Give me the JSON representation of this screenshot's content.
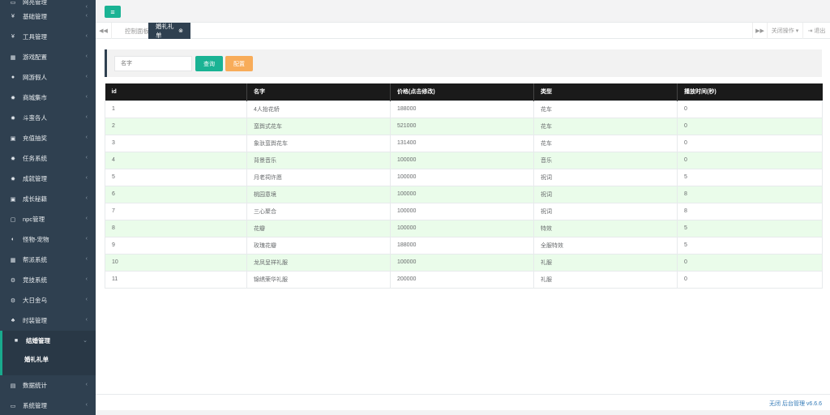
{
  "sidebar": {
    "items": [
      {
        "label": "网亮管理",
        "icon": "monitor-icon",
        "glyph": "▭"
      },
      {
        "label": "基础管理",
        "icon": "cutlery-icon",
        "glyph": "¥"
      },
      {
        "label": "工具管理",
        "icon": "cutlery-icon",
        "glyph": "¥"
      },
      {
        "label": "游戏配置",
        "icon": "grid-icon",
        "glyph": "▦"
      },
      {
        "label": "网游假人",
        "icon": "user-icon",
        "glyph": "●"
      },
      {
        "label": "商城集市",
        "icon": "gear-icon",
        "glyph": "✸"
      },
      {
        "label": "斗蛮各人",
        "icon": "gear-icon",
        "glyph": "✸"
      },
      {
        "label": "充值抽奖",
        "icon": "ticket-icon",
        "glyph": "▣"
      },
      {
        "label": "任务系统",
        "icon": "gear-icon",
        "glyph": "✸"
      },
      {
        "label": "成就管理",
        "icon": "gear-icon",
        "glyph": "✸"
      },
      {
        "label": "成长秘籍",
        "icon": "card-icon",
        "glyph": "▣"
      },
      {
        "label": "npc管理",
        "icon": "square-icon",
        "glyph": "▢"
      },
      {
        "label": "怪物-宠物",
        "icon": "halfcircle-icon",
        "glyph": "◐"
      },
      {
        "label": "帮派系统",
        "icon": "grid-icon",
        "glyph": "▦"
      },
      {
        "label": "竞技系统",
        "icon": "cogs-icon",
        "glyph": "⚙"
      },
      {
        "label": "大日金乌",
        "icon": "cogs-icon",
        "glyph": "⚙"
      },
      {
        "label": "时装管理",
        "icon": "users-icon",
        "glyph": "♣"
      },
      {
        "label": "结婚管理",
        "icon": "square-filled-icon",
        "glyph": "■"
      }
    ],
    "sub_item": "婚礼礼单",
    "bottom_items": [
      {
        "label": "数据统计",
        "icon": "list-icon",
        "glyph": "▤"
      },
      {
        "label": "系统管理",
        "icon": "monitor-icon",
        "glyph": "▭"
      }
    ]
  },
  "topbar": {
    "menu_glyph": "≡"
  },
  "tabs": {
    "prev_glyph": "◀◀",
    "items": [
      "控制面板",
      "婚礼礼单"
    ],
    "close_glyph": "⊗",
    "next_glyph": "▶▶",
    "close_ops": "关闭操作 ▾",
    "logout": "⇥ 退出"
  },
  "search": {
    "placeholder": "名字",
    "query_label": "查询",
    "config_label": "配置"
  },
  "table": {
    "headers": [
      "id",
      "名字",
      "价格(点击修改)",
      "类型",
      "播放时间(秒)"
    ],
    "rows": [
      [
        "1",
        "4人抬花轿",
        "188000",
        "花车",
        "0"
      ],
      [
        "2",
        "蛮舆式花车",
        "521000",
        "花车",
        "0"
      ],
      [
        "3",
        "象驮蛮舆花车",
        "131400",
        "花车",
        "0"
      ],
      [
        "4",
        "背景音乐",
        "100000",
        "音乐",
        "0"
      ],
      [
        "5",
        "月老祠许愿",
        "100000",
        "祝词",
        "5"
      ],
      [
        "6",
        "桃园意境",
        "100000",
        "祝词",
        "8"
      ],
      [
        "7",
        "三心聚合",
        "100000",
        "祝词",
        "8"
      ],
      [
        "8",
        "花瓣",
        "100000",
        "特效",
        "5"
      ],
      [
        "9",
        "玫瑰花瓣",
        "188000",
        "全服特效",
        "5"
      ],
      [
        "10",
        "龙凤呈祥礼服",
        "100000",
        "礼服",
        "0"
      ],
      [
        "11",
        "锦绣荣华礼服",
        "200000",
        "礼服",
        "0"
      ]
    ]
  },
  "footer": {
    "text": "无闭 后台管理 v6.6.6"
  }
}
